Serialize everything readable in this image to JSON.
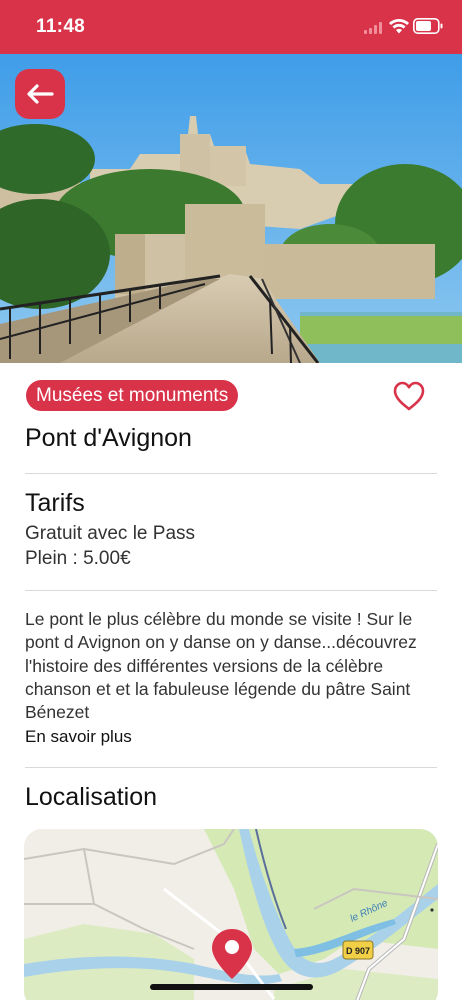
{
  "status_bar": {
    "time": "11:48",
    "background": "#d9334a"
  },
  "header": {
    "back_icon": "arrow-left-icon"
  },
  "place": {
    "category": "Musées et monuments",
    "title": "Pont d'Avignon",
    "favorite_icon": "heart-outline-icon"
  },
  "pricing": {
    "heading": "Tarifs",
    "lines": [
      "Gratuit avec le Pass",
      "Plein : 5.00€"
    ]
  },
  "description": {
    "text": "Le pont le plus célèbre du monde se visite ! Sur le pont d Avignon on y danse on y danse...découvrez l'histoire des différentes versions de la célèbre chanson et et la fabuleuse légende du pâtre Saint Bénezet",
    "more_label": "En savoir plus"
  },
  "location": {
    "heading": "Localisation",
    "map_labels": {
      "river": "le Rhône",
      "road": "D 907"
    },
    "pin_icon": "map-pin-icon"
  },
  "colors": {
    "accent": "#d9334a",
    "text": "#111111",
    "divider": "#d9d9d9"
  }
}
